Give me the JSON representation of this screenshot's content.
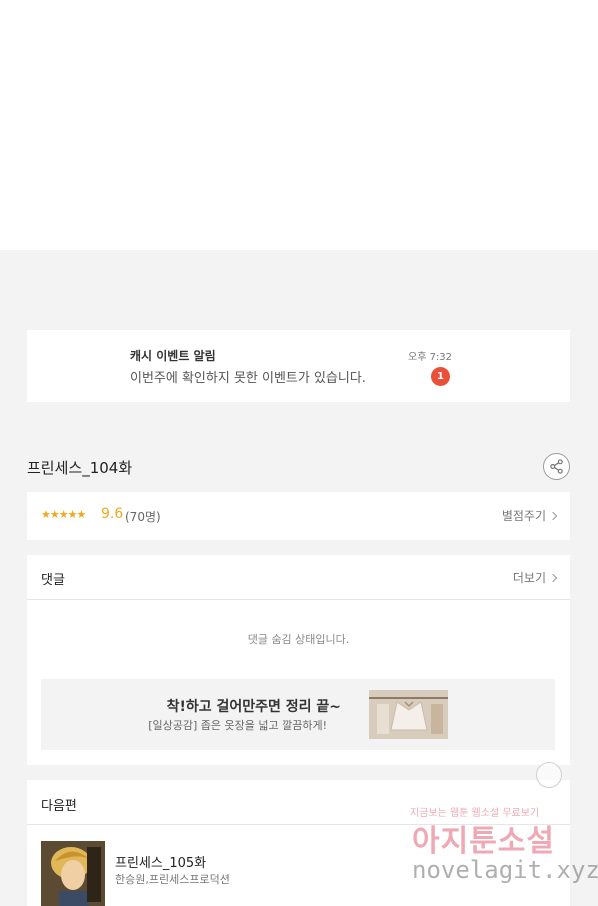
{
  "notification": {
    "title": "캐시 이벤트 알림",
    "message": "이번주에 확인하지 못한 이벤트가 있습니다.",
    "time": "오후 7:32",
    "badge_count": "1"
  },
  "episode": {
    "title": "프린세스_104화",
    "share_icon": "share-icon"
  },
  "rating": {
    "stars": "★★★★★",
    "score": "9.6",
    "count": "(70명)",
    "rate_label": "별점주기",
    "accent_color": "#f2a81d"
  },
  "comments": {
    "title": "댓글",
    "more_label": "더보기",
    "hidden_message": "댓글 숨김 상태입니다."
  },
  "ad": {
    "title": "착!하고 걸어만주면 정리 끝~",
    "subtitle": "[일상공감] 좁은 옷장을 넓고 깔끔하게!"
  },
  "next_episode": {
    "section_title": "다음편",
    "title": "프린세스_105화",
    "authors": "한승원,프린세스프로덕션"
  },
  "watermark": {
    "line1": "지금보는 웹툰 웹소설 무료보기",
    "line2": "아지툰소설",
    "line3": "novelagit.xyz"
  }
}
